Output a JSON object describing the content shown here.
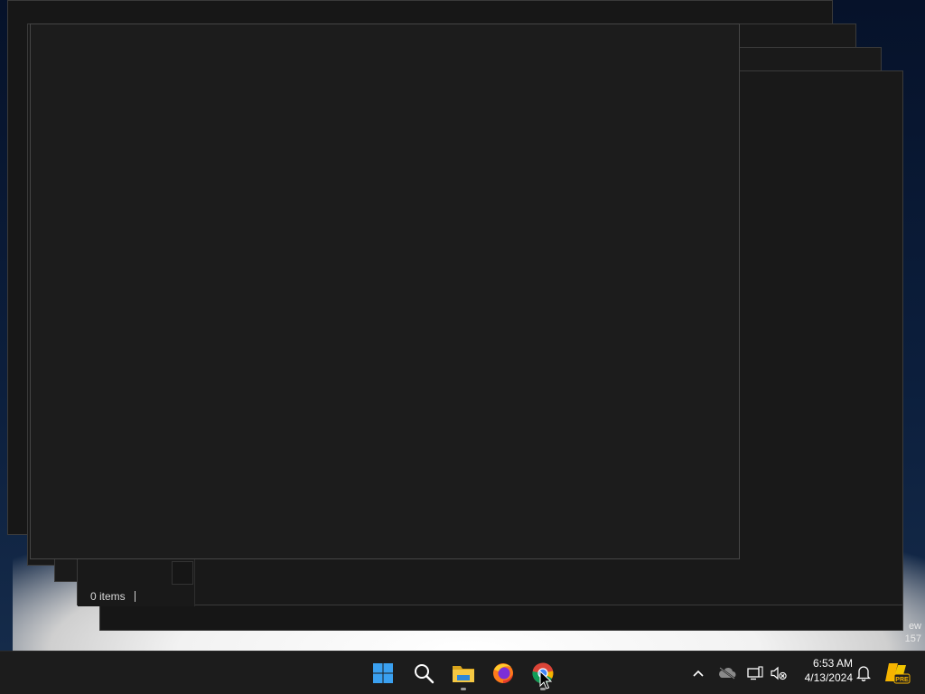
{
  "explorer": {
    "status_items": "0 items"
  },
  "desktop": {
    "icon_label_line1": "ew",
    "icon_label_line2": "157"
  },
  "taskbar": {
    "apps": [
      {
        "name": "Start",
        "icon": "windows-start-icon"
      },
      {
        "name": "Search",
        "icon": "search-icon"
      },
      {
        "name": "File Explorer",
        "icon": "file-explorer-icon",
        "running": true
      },
      {
        "name": "Firefox",
        "icon": "firefox-icon"
      },
      {
        "name": "Chrome",
        "icon": "chrome-icon",
        "running": true
      }
    ],
    "tray": {
      "show_hidden_icon": "chevron-up-icon",
      "onedrive_icon": "onedrive-offline-icon",
      "network_icon": "network-icon",
      "volume_icon": "volume-muted-icon",
      "notification_icon": "bell-icon",
      "copilot_icon": "copilot-pre-icon",
      "copilot_badge": "PRE"
    },
    "clock": {
      "time": "6:53 AM",
      "date": "4/13/2024"
    }
  },
  "colors": {
    "taskbar_bg": "#1c1c1c",
    "window_bg": "#1c1c1c",
    "accent_blue": "#3aa0f0"
  }
}
